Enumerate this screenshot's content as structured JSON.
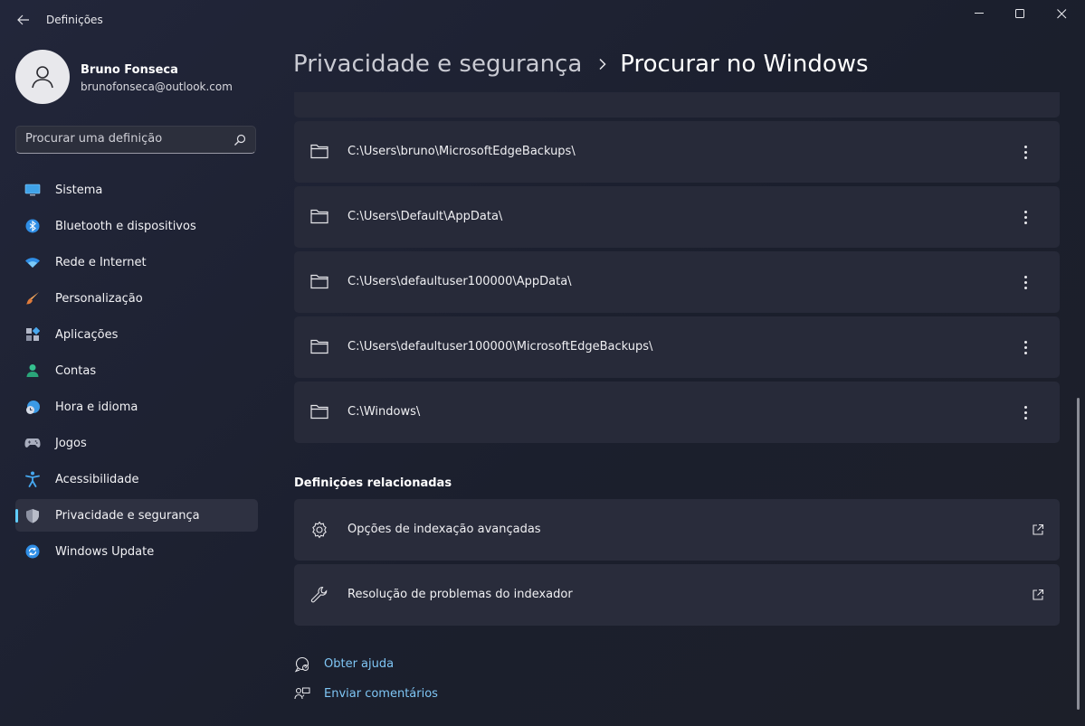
{
  "window": {
    "title": "Definições"
  },
  "user": {
    "name": "Bruno Fonseca",
    "email": "brunofonseca@outlook.com"
  },
  "search": {
    "placeholder": "Procurar uma definição"
  },
  "nav": {
    "items": [
      {
        "label": "Sistema",
        "icon": "monitor-icon"
      },
      {
        "label": "Bluetooth e dispositivos",
        "icon": "bluetooth-icon"
      },
      {
        "label": "Rede e Internet",
        "icon": "wifi-icon"
      },
      {
        "label": "Personalização",
        "icon": "paintbrush-icon"
      },
      {
        "label": "Aplicações",
        "icon": "apps-icon"
      },
      {
        "label": "Contas",
        "icon": "person-icon"
      },
      {
        "label": "Hora e idioma",
        "icon": "globe-clock-icon"
      },
      {
        "label": "Jogos",
        "icon": "gamepad-icon"
      },
      {
        "label": "Acessibilidade",
        "icon": "accessibility-icon"
      },
      {
        "label": "Privacidade e segurança",
        "icon": "shield-icon",
        "selected": true
      },
      {
        "label": "Windows Update",
        "icon": "update-icon"
      }
    ]
  },
  "header": {
    "parent": "Privacidade e segurança",
    "current": "Procurar no Windows"
  },
  "excluded_folders": [
    {
      "path": "C:\\Users\\bruno\\MicrosoftEdgeBackups\\"
    },
    {
      "path": "C:\\Users\\Default\\AppData\\"
    },
    {
      "path": "C:\\Users\\defaultuser100000\\AppData\\"
    },
    {
      "path": "C:\\Users\\defaultuser100000\\MicrosoftEdgeBackups\\"
    },
    {
      "path": "C:\\Windows\\"
    }
  ],
  "related": {
    "title": "Definições relacionadas",
    "items": [
      {
        "label": "Opções de indexação avançadas",
        "icon": "gear-icon"
      },
      {
        "label": "Resolução de problemas do indexador",
        "icon": "wrench-icon"
      }
    ]
  },
  "help": {
    "get_help": "Obter ajuda",
    "feedback": "Enviar comentários"
  },
  "colors": {
    "accent": "#60cdff",
    "link": "#7fc6f5",
    "background": "#1d2130",
    "card": "#272a39"
  }
}
